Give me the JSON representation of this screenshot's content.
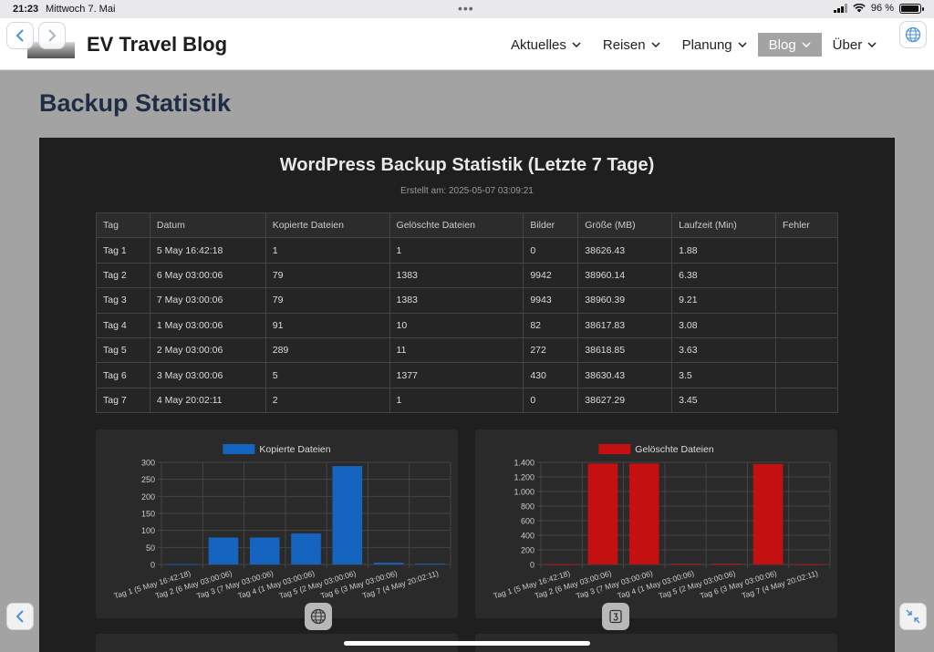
{
  "status": {
    "time": "21:23",
    "date": "Mittwoch 7. Mai",
    "battery": "96 %",
    "battery_level": 0.96
  },
  "header": {
    "site_title": "EV Travel Blog",
    "menu": [
      {
        "label": "Aktuelles",
        "active": false
      },
      {
        "label": "Reisen",
        "active": false
      },
      {
        "label": "Planung",
        "active": false
      },
      {
        "label": "Blog",
        "active": true
      },
      {
        "label": "Über",
        "active": false
      }
    ]
  },
  "page": {
    "title": "Backup Statistik"
  },
  "report": {
    "title": "WordPress Backup Statistik (Letzte 7 Tage)",
    "created": "Erstellt am: 2025-05-07 03:09:21",
    "columns": [
      "Tag",
      "Datum",
      "Kopierte Dateien",
      "Gelöschte Dateien",
      "Bilder",
      "Größe (MB)",
      "Laufzeit (Min)",
      "Fehler"
    ],
    "rows": [
      [
        "Tag 1",
        "5 May 16:42:18",
        "1",
        "1",
        "0",
        "38626.43",
        "1.88",
        ""
      ],
      [
        "Tag 2",
        "6 May 03:00:06",
        "79",
        "1383",
        "9942",
        "38960.14",
        "6.38",
        ""
      ],
      [
        "Tag 3",
        "7 May 03:00:06",
        "79",
        "1383",
        "9943",
        "38960.39",
        "9.21",
        ""
      ],
      [
        "Tag 4",
        "1 May 03:00:06",
        "91",
        "10",
        "82",
        "38617.83",
        "3.08",
        ""
      ],
      [
        "Tag 5",
        "2 May 03:00:06",
        "289",
        "11",
        "272",
        "38618.85",
        "3.63",
        ""
      ],
      [
        "Tag 6",
        "3 May 03:00:06",
        "5",
        "1377",
        "430",
        "38630.43",
        "3.5",
        ""
      ],
      [
        "Tag 7",
        "4 May 20:02:11",
        "2",
        "1",
        "0",
        "38627.29",
        "3.45",
        ""
      ]
    ]
  },
  "chart_data": [
    {
      "type": "bar",
      "legend": "Kopierte Dateien",
      "color": "#1565c0",
      "categories": [
        "Tag 1 (5 May 16:42:18)",
        "Tag 2 (6 May 03:00:06)",
        "Tag 3 (7 May 03:00:06)",
        "Tag 4 (1 May 03:00:06)",
        "Tag 5 (2 May 03:00:06)",
        "Tag 6 (3 May 03:00:06)",
        "Tag 7 (4 May 20:02:11)"
      ],
      "values": [
        1,
        79,
        79,
        91,
        289,
        5,
        2
      ],
      "ylim": [
        0,
        300
      ],
      "yticks": [
        0,
        50,
        100,
        150,
        200,
        250,
        300
      ],
      "ytick_labels": [
        "0",
        "50",
        "100",
        "150",
        "200",
        "250",
        "300"
      ],
      "grid": true,
      "legend_position": "top"
    },
    {
      "type": "bar",
      "legend": "Gelöschte Dateien",
      "color": "#c41010",
      "categories": [
        "Tag 1 (5 May 16:42:18)",
        "Tag 2 (6 May 03:00:06)",
        "Tag 3 (7 May 03:00:06)",
        "Tag 4 (1 May 03:00:06)",
        "Tag 5 (2 May 03:00:06)",
        "Tag 6 (3 May 03:00:06)",
        "Tag 7 (4 May 20:02:11)"
      ],
      "values": [
        1,
        1383,
        1383,
        10,
        11,
        1377,
        1
      ],
      "ylim": [
        0,
        1400
      ],
      "yticks": [
        0,
        200,
        400,
        600,
        800,
        1000,
        1200,
        1400
      ],
      "ytick_labels": [
        "0",
        "200",
        "400",
        "600",
        "800",
        "1.000",
        "1.200",
        "1.400"
      ],
      "grid": true,
      "legend_position": "top"
    }
  ]
}
